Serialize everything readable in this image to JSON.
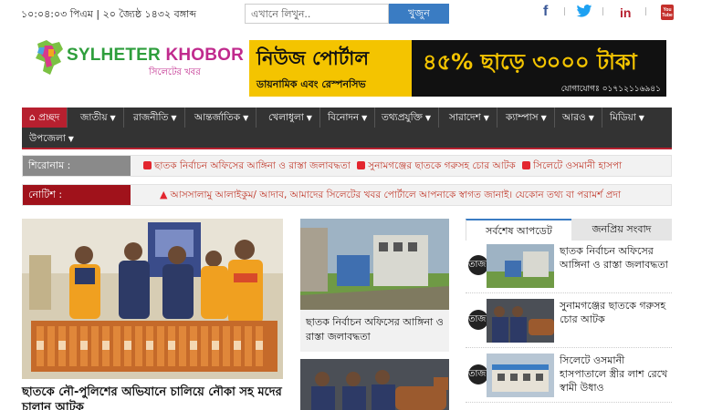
{
  "topbar": {
    "datetime": "১০:০৪:০৩ পিএম | ২০ জ্যৈষ্ঠ ১৪৩২ বঙ্গাব্দ",
    "search_placeholder": "এখানে লিখুন..",
    "search_button": "খুজুন",
    "social": [
      {
        "icon": "facebook-icon",
        "glyph": "f",
        "color": "#3b5998"
      },
      {
        "icon": "twitter-icon",
        "glyph": "t",
        "color": "#1da1f2"
      },
      {
        "icon": "linkedin-icon",
        "glyph": "in",
        "color": "#b7202f"
      },
      {
        "icon": "youtube-icon",
        "glyph": "You Tube",
        "color": "#c4302b"
      }
    ]
  },
  "logo": {
    "title_part1": "SYLHETER ",
    "title_part2": "KHOBOR",
    "subtitle": "সিলেটের খবর"
  },
  "banner": {
    "line1": "নিউজ পোর্টাল",
    "line2": "ডায়নামিক এবং রেস্পনসিভ",
    "line3": "৪৫% ছাড়ে ৩০০০ টাকা",
    "line4": "যোগাযোগঃ ০১৭১২১১৬৯৪১"
  },
  "nav": {
    "items": [
      {
        "label": "প্রচ্ছদ",
        "home": true
      },
      {
        "label": "জাতীয়"
      },
      {
        "label": "রাজনীতি"
      },
      {
        "label": "আন্তর্জাতিক"
      },
      {
        "label": "খেলাধুলা"
      },
      {
        "label": "বিনোদন"
      },
      {
        "label": "তথ্যপ্রযুক্তি"
      },
      {
        "label": "সারাদেশ"
      },
      {
        "label": "ক্যাম্পাস"
      },
      {
        "label": "আরও"
      },
      {
        "label": "মিডিয়া"
      },
      {
        "label": "উপজেলা"
      }
    ]
  },
  "headline_ticker": {
    "label": "শিরোনাম :",
    "label_color": "#8a8a8a",
    "items": [
      "ছাতক নির্বাচন অফিসের আঙ্গিনা ও রাস্তা জলাবদ্ধতা",
      "সুনামগঞ্জের ছাতকে গরুসহ চোর আটক",
      "সিলেটে ওসমানী হাসপা"
    ]
  },
  "notice_ticker": {
    "label": "নোটিশ :",
    "label_color": "#a0121b",
    "text": "আসসালামু আলাইকুম/ আদাব, আমাদের সিলেটের খবর পোর্টালে আপনাকে স্বাগত জানাই। যেকোন তথ্য বা পরামর্শ প্রদা"
  },
  "lead_story": {
    "title": "ছাতকে নৌ-পুলিশের অভিযানে চালিয়ে নৌকা সহ মদের চালান আটক"
  },
  "story_2": {
    "title": "ছাতক নির্বাচন অফিসের আঙ্গিনা ও রাস্তা জলাবদ্ধতা"
  },
  "sidebar": {
    "tab_latest": "সর্বশেষ আপডেট",
    "tab_popular": "জনপ্রিয় সংবাদ",
    "items": [
      {
        "num": "তাজা",
        "title": "ছাতক নির্বাচন অফিসের আঙ্গিনা ও রাস্তা জলাবদ্ধতা"
      },
      {
        "num": "তাজা",
        "title": "সুনামগঞ্জের ছাতকে গরুসহ চোর আটক"
      },
      {
        "num": "তাজা",
        "title": "সিলেটে ওসমানী হাসপাতালে স্ত্রীর লাশ রেখে স্বামী উধাও"
      }
    ]
  },
  "colors": {
    "accent_red": "#b7202f",
    "nav_bg": "#333333",
    "search_blue": "#3a7cc3",
    "banner_yellow": "#f4c400"
  }
}
